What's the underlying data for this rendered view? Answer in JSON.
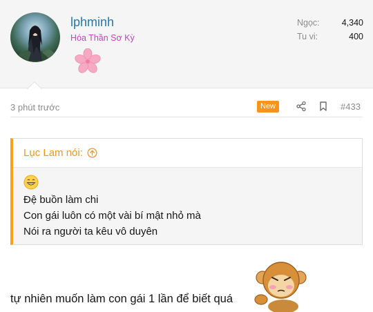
{
  "user": {
    "name": "lphminh",
    "title": "Hóa Thần Sơ Kỳ",
    "avatar": "avatar-image",
    "flair": "sakura-flower-icon",
    "stats": [
      {
        "label": "Ngọc:",
        "value": "4,340"
      },
      {
        "label": "Tu vi:",
        "value": "400"
      }
    ]
  },
  "meta": {
    "time": "3 phút trước",
    "badge": "New",
    "share_icon": "share-icon",
    "bookmark_icon": "bookmark-icon",
    "post_number": "#433"
  },
  "quote": {
    "author": "Lục Lam nói:",
    "jump_icon": "arrow-up-circle-icon",
    "emoji": "grinning-face-emoji",
    "lines": [
      "Đệ buồn làm chi",
      "Con gái luôn có một vài bí mật nhỏ mà",
      "Nói ra người ta kêu vô duyên"
    ]
  },
  "body": {
    "text": "tự nhiên muốn làm con gái 1 lần để biết quá",
    "sticker": "monkey-sticker"
  },
  "colors": {
    "username": "#2577b1",
    "title": "#c542c5",
    "badge": "#f7941d",
    "quote_accent": "#f7a21d",
    "header_bg": "#f5f5f5"
  }
}
